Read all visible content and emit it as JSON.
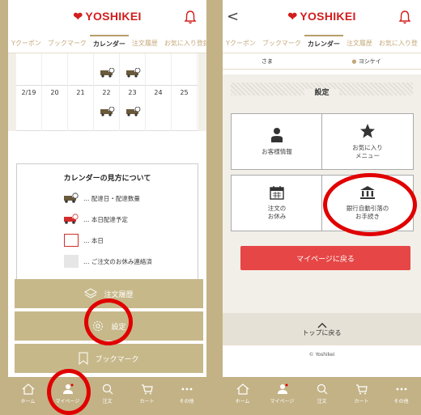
{
  "brand": {
    "logo_text": "YOSHIKEI",
    "logo_color": "#d31d1d"
  },
  "colors": {
    "accent": "#c3b286",
    "highlight": "#e00000",
    "button_red": "#e64646"
  },
  "tabs": [
    "MYクーポン",
    "ブックマーク",
    "カレンダー",
    "注文履歴",
    "お気に入り登録"
  ],
  "tabs_left_visible": [
    "Yクーポン",
    "ブックマーク",
    "カレンダー",
    "注文履歴",
    "お気に入り登録"
  ],
  "tabs_right_visible": [
    "Yクーポン",
    "ブックマーク",
    "カレンダー",
    "注文履歴",
    "お気に入り登"
  ],
  "active_tab": "カレンダー",
  "calendar": {
    "dates": [
      "2/19",
      "20",
      "21",
      "22",
      "23",
      "24",
      "25"
    ]
  },
  "legend": {
    "title": "カレンダーの見方について",
    "items": [
      {
        "text": "… 配達日・配達数量",
        "icon": "truck-brown-icon"
      },
      {
        "text": "… 本日配達予定",
        "icon": "truck-red-icon"
      },
      {
        "text": "… 本日",
        "icon": "red-square"
      },
      {
        "text": "… ご注文のお休み連絡済",
        "icon": "gray-square"
      }
    ]
  },
  "menu": {
    "order_history": "注文履歴",
    "settings": "設定",
    "bookmark": "ブックマーク"
  },
  "bottom_nav": [
    "ホーム",
    "マイページ",
    "注文",
    "カート",
    "その他"
  ],
  "right": {
    "user_name": "さま",
    "store": "ヨシケイ",
    "settings_title": "設定",
    "tiles": {
      "customer_info": "お客様情報",
      "favorites_line1": "お気に入り",
      "favorites_line2": "メニュー",
      "order_rest_line1": "注文の",
      "order_rest_line2": "お休み",
      "bank_line1": "銀行自動引落の",
      "bank_line2": "お手続き"
    },
    "mypage_button": "マイページに戻る",
    "to_top": "トップに戻る",
    "copyright": "© Yoshikei"
  }
}
